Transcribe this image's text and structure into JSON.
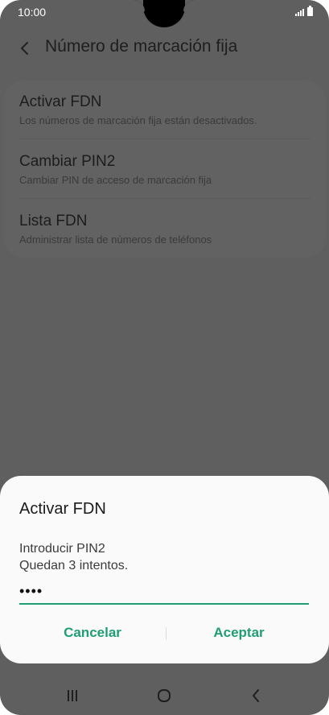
{
  "status_bar": {
    "time": "10:00"
  },
  "app_bar": {
    "title": "Número de marcación fija"
  },
  "settings": {
    "items": [
      {
        "title": "Activar FDN",
        "subtitle": "Los números de marcación fija están desactivados."
      },
      {
        "title": "Cambiar PIN2",
        "subtitle": "Cambiar PIN de acceso de marcación fija"
      },
      {
        "title": "Lista FDN",
        "subtitle": "Administrar lista de números de teléfonos"
      }
    ]
  },
  "dialog": {
    "title": "Activar FDN",
    "message_line1": "Introducir PIN2",
    "message_line2": "Quedan 3 intentos.",
    "pin_value": "••••",
    "cancel_label": "Cancelar",
    "accept_label": "Aceptar"
  },
  "colors": {
    "accent": "#1f9e73",
    "scrim": "#5f5f5f"
  },
  "icons": {
    "back": "back-arrow-icon",
    "recents": "recents-icon",
    "home": "home-icon",
    "nav_back": "nav-back-icon"
  }
}
